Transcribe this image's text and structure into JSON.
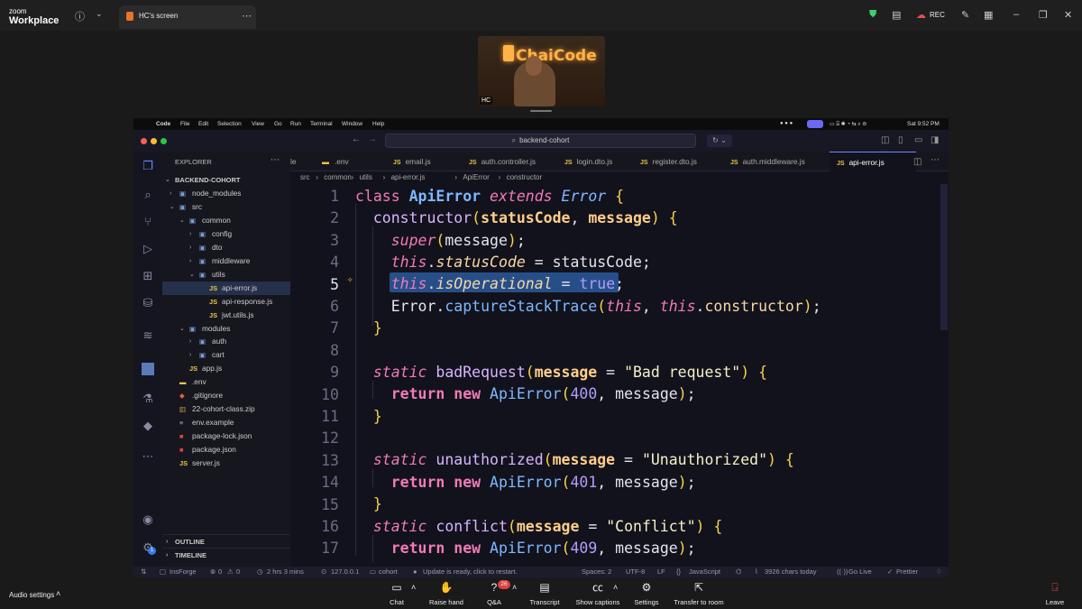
{
  "zoom": {
    "brand_line1": "zoom",
    "brand_line2": "Workplace",
    "tab_title": "HC's screen",
    "rec_label": "REC",
    "video_overlay_logo": "ChaiCode",
    "video_participant": "HC"
  },
  "mac_menu": {
    "app": "Code",
    "items": [
      "File",
      "Edit",
      "Selection",
      "View",
      "Go",
      "Run",
      "Terminal",
      "Window",
      "Help"
    ],
    "clock": "Sat 9:52 PM"
  },
  "vscode": {
    "search": "backend-cohort",
    "explorer_title": "EXPLORER",
    "project": "BACKEND-COHORT",
    "tree": [
      {
        "label": "node_modules",
        "depth": 1,
        "kind": "folder",
        "open": false
      },
      {
        "label": "src",
        "depth": 1,
        "kind": "folder",
        "open": true
      },
      {
        "label": "common",
        "depth": 2,
        "kind": "folder",
        "open": true
      },
      {
        "label": "config",
        "depth": 3,
        "kind": "folder",
        "open": false
      },
      {
        "label": "dto",
        "depth": 3,
        "kind": "folder",
        "open": false
      },
      {
        "label": "middleware",
        "depth": 3,
        "kind": "folder",
        "open": false
      },
      {
        "label": "utils",
        "depth": 3,
        "kind": "folder",
        "open": true
      },
      {
        "label": "api-error.js",
        "depth": 4,
        "kind": "js",
        "selected": true
      },
      {
        "label": "api-response.js",
        "depth": 4,
        "kind": "js"
      },
      {
        "label": "jwt.utils.js",
        "depth": 4,
        "kind": "js"
      },
      {
        "label": "modules",
        "depth": 2,
        "kind": "folder",
        "open": true
      },
      {
        "label": "auth",
        "depth": 3,
        "kind": "folder",
        "open": false
      },
      {
        "label": "cart",
        "depth": 3,
        "kind": "folder",
        "open": false
      },
      {
        "label": "app.js",
        "depth": 2,
        "kind": "js"
      },
      {
        "label": ".env",
        "depth": 1,
        "kind": "env"
      },
      {
        "label": ".gitignore",
        "depth": 1,
        "kind": "git"
      },
      {
        "label": "22-cohort-class.zip",
        "depth": 1,
        "kind": "zip"
      },
      {
        "label": "env.example",
        "depth": 1,
        "kind": "text"
      },
      {
        "label": "package-lock.json",
        "depth": 1,
        "kind": "npm"
      },
      {
        "label": "package.json",
        "depth": 1,
        "kind": "npm"
      },
      {
        "label": "server.js",
        "depth": 1,
        "kind": "js"
      }
    ],
    "outline": "OUTLINE",
    "timeline": "TIMELINE",
    "tabs": [
      {
        "label": "le",
        "js": false
      },
      {
        "label": ".env",
        "js": false
      },
      {
        "label": "email.js",
        "js": true
      },
      {
        "label": "auth.controller.js",
        "js": true
      },
      {
        "label": "login.dto.js",
        "js": true
      },
      {
        "label": "register.dto.js",
        "js": true
      },
      {
        "label": "auth.middleware.js",
        "js": true
      },
      {
        "label": "api-error.js",
        "js": true,
        "active": true
      }
    ],
    "breadcrumb": [
      "src",
      "common",
      "utils",
      "api-error.js",
      "ApiError",
      "constructor"
    ],
    "line_numbers": [
      "1",
      "2",
      "3",
      "4",
      "5",
      "6",
      "7",
      "8",
      "9",
      "10",
      "11",
      "12",
      "13",
      "14",
      "15",
      "16",
      "17"
    ],
    "current_line": "5",
    "status": {
      "branch_icon": "⇅",
      "insforge": "InsForge",
      "errors": "0",
      "warnings": "0",
      "time": "2 hrs 3 mins",
      "host": "127.0.0.1",
      "folder": "cohort",
      "update": "Update is ready, click to restart.",
      "spaces": "Spaces: 2",
      "encoding": "UTF-8",
      "eol": "LF",
      "language": "JavaScript",
      "chars": "3926 chars today",
      "golive": "Go Live",
      "prettier": "Prettier"
    }
  },
  "zoom_bottom": {
    "audio": "Audio settings",
    "chat": "Chat",
    "raise": "Raise hand",
    "qa": "Q&A",
    "qa_badge": "26",
    "transcript": "Transcript",
    "captions": "Show captions",
    "settings": "Settings",
    "transfer": "Transfer to room",
    "leave": "Leave"
  }
}
